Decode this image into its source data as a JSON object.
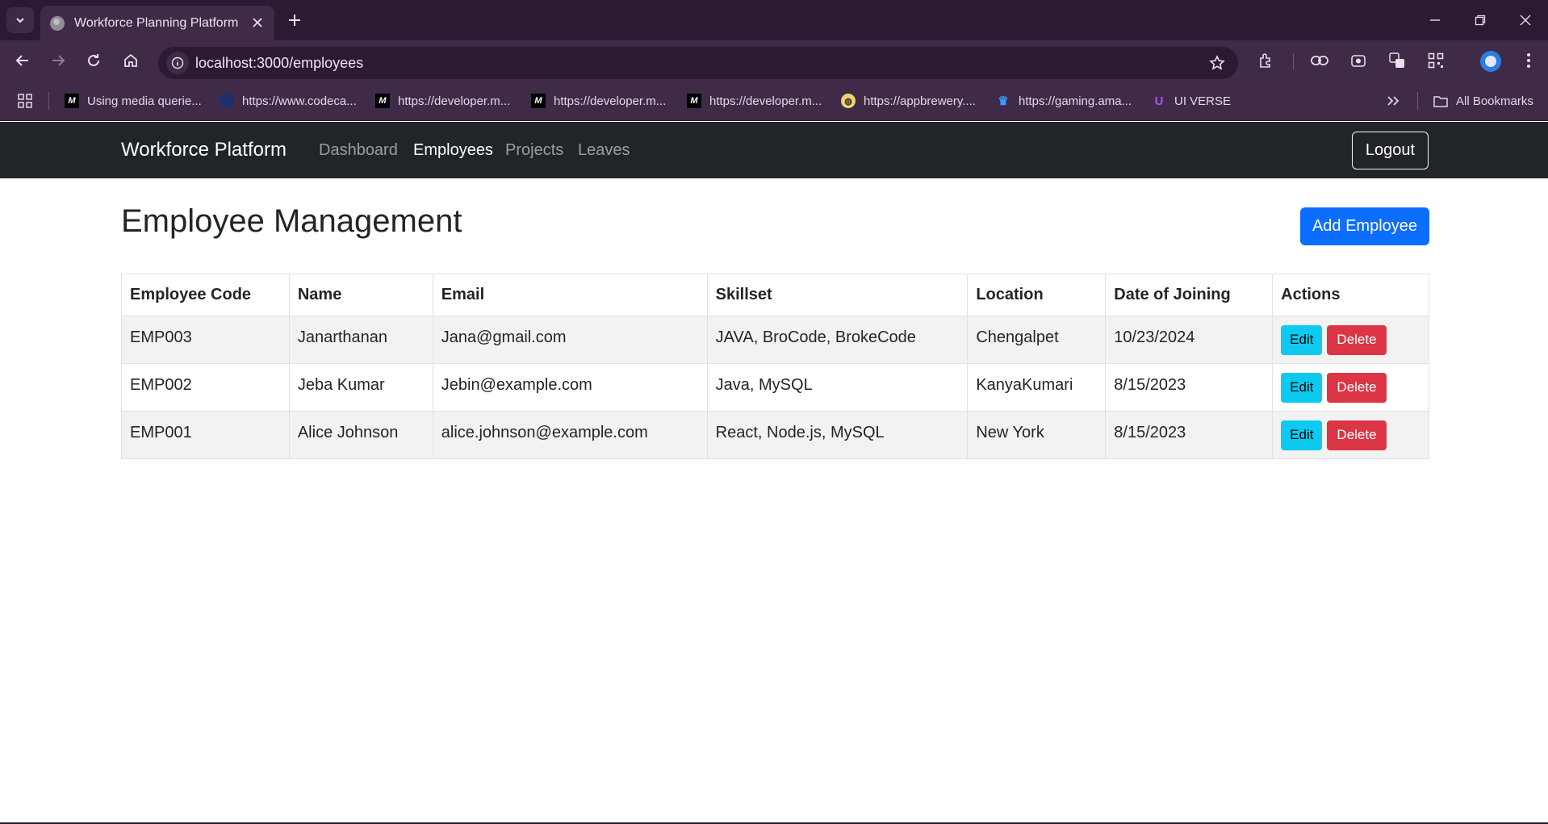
{
  "browser": {
    "tab_title": "Workforce Planning Platform",
    "url": "localhost:3000/employees",
    "bookmarks": [
      {
        "label": "Using media querie...",
        "icon": "mdn-icon"
      },
      {
        "label": "https://www.codeca...",
        "icon": "codecademy-icon"
      },
      {
        "label": "https://developer.m...",
        "icon": "mdn-icon"
      },
      {
        "label": "https://developer.m...",
        "icon": "mdn-icon"
      },
      {
        "label": "https://developer.m...",
        "icon": "mdn-icon"
      },
      {
        "label": "https://appbrewery....",
        "icon": "appbrewery-icon"
      },
      {
        "label": "https://gaming.ama...",
        "icon": "crown-icon"
      },
      {
        "label": "UI VERSE",
        "icon": "uiverse-icon"
      }
    ],
    "all_bookmarks": "All Bookmarks"
  },
  "navbar": {
    "brand": "Workforce Platform",
    "links": [
      "Dashboard",
      "Employees",
      "Projects",
      "Leaves"
    ],
    "active": "Employees",
    "logout": "Logout"
  },
  "main": {
    "title": "Employee Management",
    "add_button": "Add Employee",
    "table": {
      "headers": [
        "Employee Code",
        "Name",
        "Email",
        "Skillset",
        "Location",
        "Date of Joining",
        "Actions"
      ],
      "rows": [
        [
          "EMP003",
          "Janarthanan",
          "Jana@gmail.com",
          "JAVA, BroCode, BrokeCode",
          "Chengalpet",
          "10/23/2024"
        ],
        [
          "EMP002",
          "Jeba Kumar",
          "Jebin@example.com",
          "Java, MySQL",
          "KanyaKumari",
          "8/15/2023"
        ],
        [
          "EMP001",
          "Alice Johnson",
          "alice.johnson@example.com",
          "React, Node.js, MySQL",
          "New York",
          "8/15/2023"
        ]
      ],
      "edit_label": "Edit",
      "delete_label": "Delete"
    }
  },
  "colors": {
    "navbar_bg": "#212529",
    "primary": "#0d6efd",
    "info": "#0dcaf0",
    "danger": "#dc3545",
    "browser_chrome": "#3f2a48"
  }
}
